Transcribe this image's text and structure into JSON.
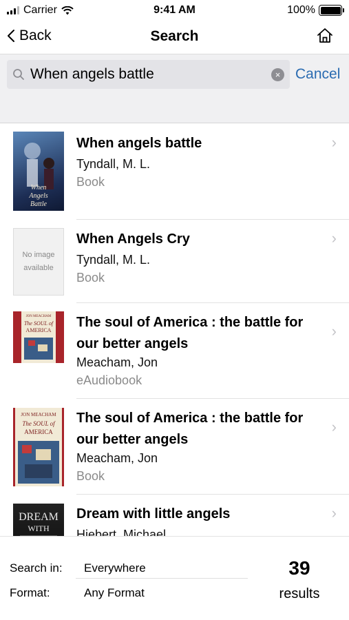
{
  "status_bar": {
    "carrier": "Carrier",
    "time": "9:41 AM",
    "battery": "100%"
  },
  "nav": {
    "back_label": "Back",
    "title": "Search"
  },
  "search": {
    "query": "When angels battle",
    "clear_glyph": "×",
    "cancel_label": "Cancel"
  },
  "results": [
    {
      "title": "When angels battle",
      "author": "Tyndall, M. L.",
      "format": "Book",
      "cover": {
        "type": "art",
        "colors": [
          "#1d2e55",
          "#5a86b8"
        ],
        "text": "When Angels Battle"
      }
    },
    {
      "title": "When Angels Cry",
      "author": "Tyndall, M. L.",
      "format": "Book",
      "cover": {
        "type": "placeholder",
        "text": "No image available"
      }
    },
    {
      "title": "The soul of America : the battle for our better angels",
      "author": "Meacham, Jon",
      "format": "eAudiobook",
      "cover": {
        "type": "art",
        "colors": [
          "#a8242a",
          "#f1ead6"
        ],
        "text": "The Soul of America"
      }
    },
    {
      "title": "The soul of America : the battle for our better angels",
      "author": "Meacham, Jon",
      "format": "Book",
      "cover": {
        "type": "art",
        "colors": [
          "#f1ead6",
          "#a8242a"
        ],
        "text": "JON MEACHAM The Soul of America"
      }
    },
    {
      "title": "Dream with little angels",
      "author": "Hiebert, Michael",
      "format": "",
      "cover": {
        "type": "art",
        "colors": [
          "#121212",
          "#4a4a4a"
        ],
        "text": "DREAM WITH"
      }
    }
  ],
  "footer": {
    "search_in_label": "Search in:",
    "search_in_value": "Everywhere",
    "format_label": "Format:",
    "format_value": "Any Format",
    "result_count": "39",
    "result_count_label": "results"
  }
}
